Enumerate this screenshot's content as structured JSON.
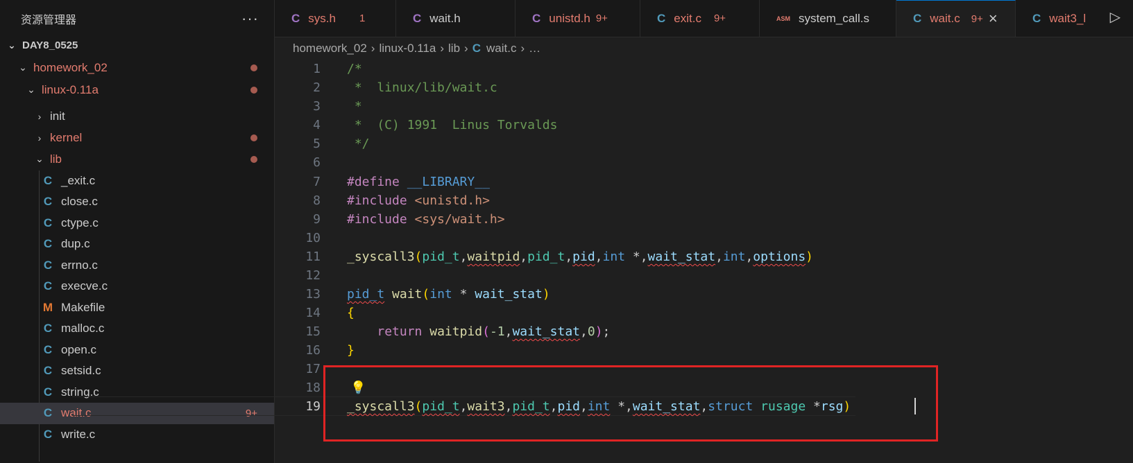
{
  "sidebar": {
    "title": "资源管理器",
    "more": "···",
    "root": "DAY8_0525",
    "folders": {
      "homework": "homework_02",
      "linux": "linux-0.11a",
      "init": "init",
      "kernel": "kernel",
      "lib": "lib"
    },
    "files": [
      {
        "icon": "C",
        "name": "_exit.c"
      },
      {
        "icon": "C",
        "name": "close.c"
      },
      {
        "icon": "C",
        "name": "ctype.c"
      },
      {
        "icon": "C",
        "name": "dup.c"
      },
      {
        "icon": "C",
        "name": "errno.c"
      },
      {
        "icon": "C",
        "name": "execve.c"
      },
      {
        "icon": "M",
        "name": "Makefile"
      },
      {
        "icon": "C",
        "name": "malloc.c"
      },
      {
        "icon": "C",
        "name": "open.c"
      },
      {
        "icon": "C",
        "name": "setsid.c"
      },
      {
        "icon": "C",
        "name": "string.c"
      },
      {
        "icon": "C",
        "name": "wait.c",
        "badge": "9+"
      },
      {
        "icon": "C",
        "name": "write.c"
      }
    ]
  },
  "tabs": [
    {
      "icon": "C",
      "label": "sys.h",
      "badge": "1"
    },
    {
      "icon": "C",
      "label": "wait.h",
      "badge": ""
    },
    {
      "icon": "C",
      "label": "unistd.h",
      "badge": "9+"
    },
    {
      "icon": "C",
      "label": "exit.c",
      "badge": "9+"
    },
    {
      "icon": "ASM",
      "label": "system_call.s",
      "badge": ""
    },
    {
      "icon": "C",
      "label": "wait.c",
      "badge": "9+",
      "close": "×"
    },
    {
      "icon": "C",
      "label": "wait3_l",
      "badge": ""
    }
  ],
  "run": "▷",
  "breadcrumb": {
    "part1": "homework_02",
    "part2": "linux-0.11a",
    "part3": "lib",
    "icon": "C",
    "part4": "wait.c",
    "more": "…",
    "sep": "›"
  },
  "line_numbers": [
    "1",
    "2",
    "3",
    "4",
    "5",
    "6",
    "7",
    "8",
    "9",
    "10",
    "11",
    "12",
    "13",
    "14",
    "15",
    "16",
    "17",
    "18",
    "19"
  ],
  "code": {
    "l1": "/*",
    "l2": " *  linux/lib/wait.c",
    "l3": " *",
    "l4": " *  (C) 1991  Linus Torvalds",
    "l5": " */",
    "l7_kw": "#define",
    "l7_macro": "__LIBRARY__",
    "l8_kw": "#include",
    "l8_str": "<unistd.h>",
    "l9_kw": "#include",
    "l9_str": "<sys/wait.h>",
    "l11": {
      "fn": "_syscall3",
      "t1": "pid_t",
      "a1": "waitpid",
      "t2": "pid_t",
      "a2": "pid",
      "t3": "int",
      "star": " *,",
      "a3": "wait_stat",
      "t4": "int",
      "a4": "options"
    },
    "l13": {
      "t": "pid_t",
      "fn": "wait",
      "t2": "int",
      "star": " * ",
      "a": "wait_stat"
    },
    "l14": "{",
    "l15": {
      "kw": "return",
      "fn": "waitpid",
      "n1": "-1",
      "a": "wait_stat",
      "n2": "0"
    },
    "l16": "}",
    "l19": {
      "fn": "_syscall3",
      "t1": "pid_t",
      "a1": "wait3",
      "t2": "pid_t",
      "a2": "pid",
      "t3": "int",
      "star": " *,",
      "a3": "wait_stat",
      "kw": "struct",
      "t4": "rusage",
      "star2": " *",
      "a4": "rsg"
    }
  },
  "lightbulb": "💡"
}
